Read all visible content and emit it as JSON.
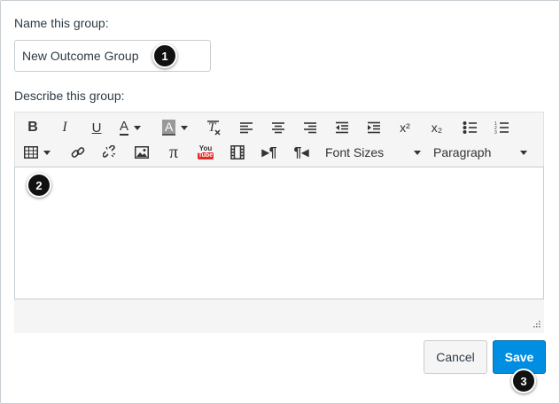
{
  "form": {
    "name_label": "Name this group:",
    "name_value": "New Outcome Group",
    "describe_label": "Describe this group:"
  },
  "toolbar": {
    "font_sizes_label": "Font Sizes",
    "paragraph_label": "Paragraph",
    "superscript_label": "x²",
    "subscript_label": "x₂",
    "youtube_label": "You Tube"
  },
  "buttons": {
    "cancel_label": "Cancel",
    "save_label": "Save"
  },
  "markers": [
    "1",
    "2",
    "3"
  ],
  "colors": {
    "save_bg": "#008ee2",
    "marker_bg": "#111111",
    "youtube_red": "#e52d27"
  }
}
